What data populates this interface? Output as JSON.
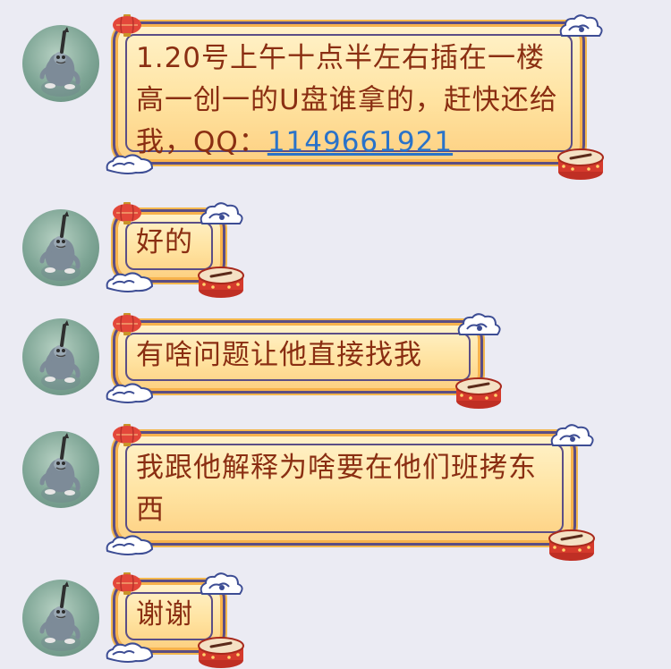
{
  "chat": {
    "messages": [
      {
        "id": "m1",
        "text_before": "1.20号上午十点半左右插在一楼高一创一的U盘谁拿的，赶快还给我，QQ：",
        "link": "1149661921"
      },
      {
        "id": "m2",
        "text": "好的"
      },
      {
        "id": "m3",
        "text": "有啥问题让他直接找我"
      },
      {
        "id": "m4",
        "text": "我跟他解释为啥要在他们班拷东西"
      },
      {
        "id": "m5",
        "text": "谢谢"
      }
    ]
  },
  "colors": {
    "background": "#ebebf3",
    "bubble_fill": "#ffe3a1",
    "bubble_border": "#5a4d84",
    "text": "#8a2e12",
    "link": "#2a73c9",
    "drum_red": "#d53a2c"
  },
  "icons": [
    "avatar-cartoon-cat",
    "lantern-icon",
    "cloud-ornament-icon",
    "drum-icon"
  ]
}
